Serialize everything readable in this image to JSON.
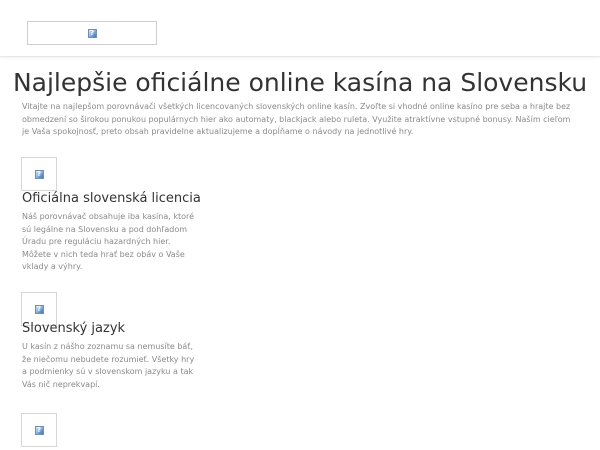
{
  "header": {
    "logo_icon": "broken-image-icon"
  },
  "main": {
    "title": "Najlepšie oficiálne online kasína na Slovensku",
    "intro": "Vitajte na najlepšom porovnávači všetkých licencovaných slovenských online kasín. Zvoľte si vhodné online kasíno pre seba a hrajte bez obmedzení so širokou ponukou populárnych hier ako automaty, blackjack alebo ruleta. Využite atraktívne vstupné bonusy. Naším cieľom je Vaša spokojnosť, preto obsah pravidelne aktualizujeme a dopĺňame o návody na jednotlivé hry.",
    "features": [
      {
        "icon": "broken-image-icon",
        "title": "Oficiálna slovenská licencia",
        "text": "Náš porovnávač obsahuje iba kasína, ktoré sú legálne na Slovensku a pod dohľadom Úradu pre reguláciu hazardných hier. Môžete v nich teda hrať bez obáv o Vaše vklady a výhry."
      },
      {
        "icon": "broken-image-icon",
        "title": "Slovenský jazyk",
        "text": "U kasín z nášho zoznamu sa nemusíte báť, že niečomu nebudete rozumieť. Všetky hry a podmienky sú v slovenskom jazyku a tak Vás nič neprekvapí."
      },
      {
        "icon": "broken-image-icon"
      }
    ]
  }
}
